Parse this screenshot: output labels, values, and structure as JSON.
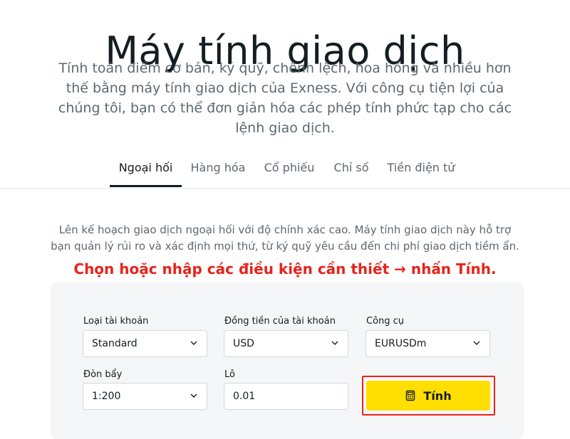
{
  "page": {
    "title": "Máy tính giao dịch",
    "subtitle": "Tính toán điểm cơ bản, ký quỹ, chênh lệch, hoa hồng và nhiều hơn thế bằng máy tính giao dịch của Exness. Với công cụ tiện lợi của chúng tôi, bạn có thể đơn giản hóa các phép tính phức tạp cho các lệnh giao dịch."
  },
  "tabs": [
    {
      "label": "Ngoại hối",
      "active": true
    },
    {
      "label": "Hàng hóa",
      "active": false
    },
    {
      "label": "Cổ phiếu",
      "active": false
    },
    {
      "label": "Chỉ số",
      "active": false
    },
    {
      "label": "Tiền điện tử",
      "active": false
    }
  ],
  "description": "Lên kế hoạch giao dịch ngoại hối với độ chính xác cao. Máy tính giao dịch này hỗ trợ bạn quản lý rủi ro và xác định mọi thứ, từ ký quỹ yêu cầu đến chi phí giao dịch tiềm ẩn.",
  "annotation": "Chọn hoặc nhập các điều kiện cần thiết → nhấn Tính.",
  "form": {
    "account_type": {
      "label": "Loại tài khoản",
      "value": "Standard"
    },
    "account_currency": {
      "label": "Đồng tiền của tài khoản",
      "value": "USD"
    },
    "instrument": {
      "label": "Công cụ",
      "value": "EURUSDm"
    },
    "leverage": {
      "label": "Đòn bẩy",
      "value": "1:200"
    },
    "lot": {
      "label": "Lô",
      "value": "0.01"
    },
    "calculate_label": "Tính"
  },
  "colors": {
    "accent": "#ffde02",
    "annotation": "#e8231a",
    "text": "#141d22",
    "muted": "#5d6871"
  },
  "icons": {
    "chevron": "chevron-down-icon",
    "calculator": "calculator-icon"
  }
}
